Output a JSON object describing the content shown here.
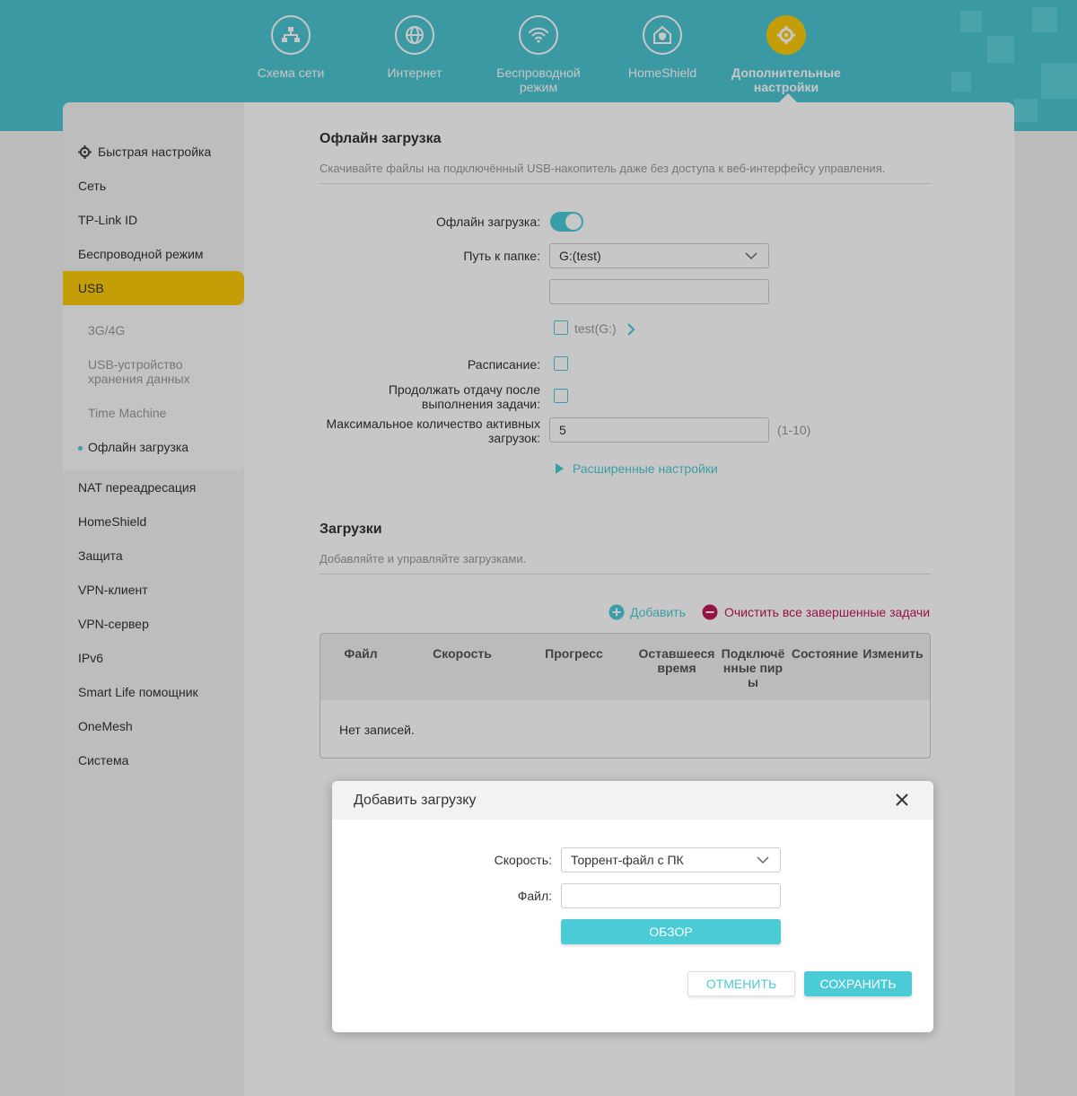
{
  "nav": {
    "items": [
      {
        "label": "Схема сети",
        "icon": "network-map-icon"
      },
      {
        "label": "Интернет",
        "icon": "globe-icon"
      },
      {
        "label": "Беспроводной режим",
        "icon": "wifi-icon"
      },
      {
        "label": "HomeShield",
        "icon": "home-shield-icon"
      },
      {
        "label": "Дополнительные настройки",
        "icon": "gear-icon"
      }
    ],
    "active_index": 4
  },
  "sidebar": {
    "items": [
      {
        "label": "Быстрая настройка",
        "icon": "gear-icon"
      },
      {
        "label": "Сеть"
      },
      {
        "label": "TP-Link ID"
      },
      {
        "label": "Беспроводной режим"
      },
      {
        "label": "USB"
      },
      {
        "label": "NAT переадресация"
      },
      {
        "label": "HomeShield"
      },
      {
        "label": "Защита"
      },
      {
        "label": "VPN-клиент"
      },
      {
        "label": "VPN-сервер"
      },
      {
        "label": "IPv6"
      },
      {
        "label": "Smart Life помощник"
      },
      {
        "label": "OneMesh"
      },
      {
        "label": "Система"
      }
    ],
    "active": "USB",
    "subitems": [
      {
        "label": "3G/4G"
      },
      {
        "label": "USB-устройство хранения данных"
      },
      {
        "label": "Time Machine"
      },
      {
        "label": "Офлайн загрузка"
      }
    ],
    "sub_active": "Офлайн загрузка"
  },
  "offline": {
    "title": "Офлайн загрузка",
    "desc": "Скачивайте файлы на подключённый USB-накопитель даже без доступа к веб-интерфейсу управления.",
    "toggle_label": "Офлайн загрузка:",
    "toggle_on": true,
    "path_label": "Путь к папке:",
    "path_value": "G:(test)",
    "path_input_value": "",
    "folder_item": "test(G:)",
    "schedule_label": "Расписание:",
    "continue_label": "Продолжать отдачу после выполнения задачи:",
    "max_label": "Максимальное количество активных загрузок:",
    "max_value": "5",
    "max_range": "(1-10)",
    "advanced": "Расширенные настройки"
  },
  "downloads": {
    "title": "Загрузки",
    "desc": "Добавляйте и управляйте загрузками.",
    "add": "Добавить",
    "clear": "Очистить все завершенные задачи",
    "columns": [
      "Файл",
      "Скорость",
      "Прогресс",
      "Оставшееся время",
      "Подключённые пиры",
      "Состояние",
      "Изменить"
    ],
    "empty": "Нет записей."
  },
  "modal": {
    "title": "Добавить загрузку",
    "speed_label": "Скорость:",
    "speed_value": "Торрент-файл с ПК",
    "file_label": "Файл:",
    "file_value": "",
    "browse": "ОБЗОР",
    "cancel": "ОТМЕНИТЬ",
    "save": "СОХРАНИТЬ"
  },
  "colors": {
    "header": "#4cc4d2",
    "accent": "#4acbd6",
    "active": "#fccb0a",
    "danger": "#c2185b"
  }
}
